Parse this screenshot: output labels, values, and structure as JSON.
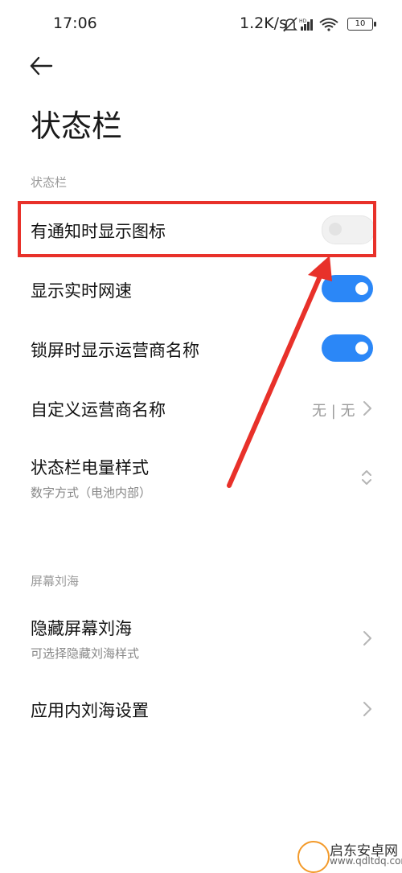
{
  "status_bar": {
    "time": "17:06",
    "net_speed": "1.2K/s",
    "battery": "10"
  },
  "header": {
    "title": "状态栏"
  },
  "sections": {
    "status_bar_header": "状态栏",
    "notch_header": "屏幕刘海"
  },
  "items": {
    "show_icon_on_notification": {
      "label": "有通知时显示图标",
      "toggle": "off"
    },
    "show_realtime_speed": {
      "label": "显示实时网速",
      "toggle": "on"
    },
    "show_carrier_on_lock": {
      "label": "锁屏时显示运营商名称",
      "toggle": "on"
    },
    "custom_carrier_name": {
      "label": "自定义运营商名称",
      "value": "无 | 无"
    },
    "battery_style": {
      "label": "状态栏电量样式",
      "sub": "数字方式（电池内部）"
    },
    "hide_notch": {
      "label": "隐藏屏幕刘海",
      "sub": "可选择隐藏刘海样式"
    },
    "app_notch_settings": {
      "label": "应用内刘海设置"
    }
  },
  "watermark": {
    "name": "启东安卓网",
    "url": "www.qdltdq.com"
  },
  "colors": {
    "accent": "#2b87f7",
    "highlight": "#e8312a"
  }
}
